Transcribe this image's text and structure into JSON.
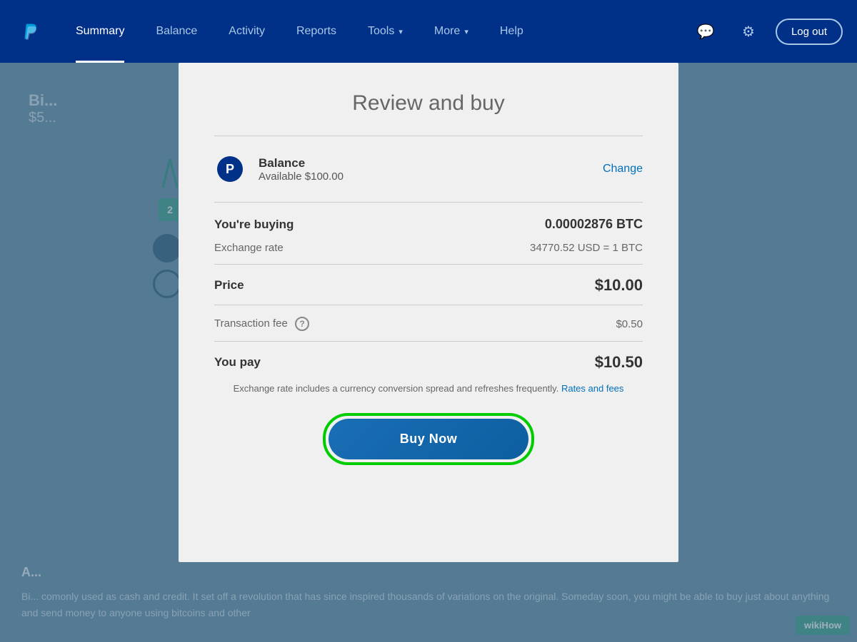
{
  "navbar": {
    "logo_label": "PayPal",
    "links": [
      {
        "id": "summary",
        "label": "Summary",
        "active": true,
        "has_dropdown": false
      },
      {
        "id": "balance",
        "label": "Balance",
        "active": false,
        "has_dropdown": false
      },
      {
        "id": "activity",
        "label": "Activity",
        "active": false,
        "has_dropdown": false
      },
      {
        "id": "reports",
        "label": "Reports",
        "active": false,
        "has_dropdown": false
      },
      {
        "id": "tools",
        "label": "Tools",
        "active": false,
        "has_dropdown": true
      },
      {
        "id": "more",
        "label": "More",
        "active": false,
        "has_dropdown": true
      },
      {
        "id": "help",
        "label": "Help",
        "active": false,
        "has_dropdown": false
      }
    ],
    "icons": {
      "message_icon": "💬",
      "settings_icon": "⚙"
    },
    "logout_label": "Log out"
  },
  "background": {
    "title": "Bi...",
    "subtitle": "$5...",
    "badge": "2",
    "article_title": "A...",
    "article_text": "Bi... comonly used as cash and credit. It set off a revolution that has since inspired thousands of variations on the original. Someday soon, you might be able to buy just about anything and send money to anyone using bitcoins and other"
  },
  "modal": {
    "title": "Review and buy",
    "payment_method": {
      "label": "Balance",
      "available": "Available $100.00",
      "change_label": "Change"
    },
    "rows": {
      "buying_label": "You're buying",
      "buying_value": "0.00002876 BTC",
      "exchange_label": "Exchange rate",
      "exchange_value": "34770.52 USD = 1 BTC",
      "price_label": "Price",
      "price_value": "$10.00",
      "fee_label": "Transaction fee",
      "fee_help": "?",
      "fee_value": "$0.50",
      "you_pay_label": "You pay",
      "you_pay_value": "$10.50"
    },
    "disclaimer": "Exchange rate includes a currency conversion spread and refreshes frequently.",
    "rates_fees_link": "Rates and fees",
    "buy_button_label": "Buy Now"
  },
  "wikihow": {
    "badge": "wikiHow"
  }
}
